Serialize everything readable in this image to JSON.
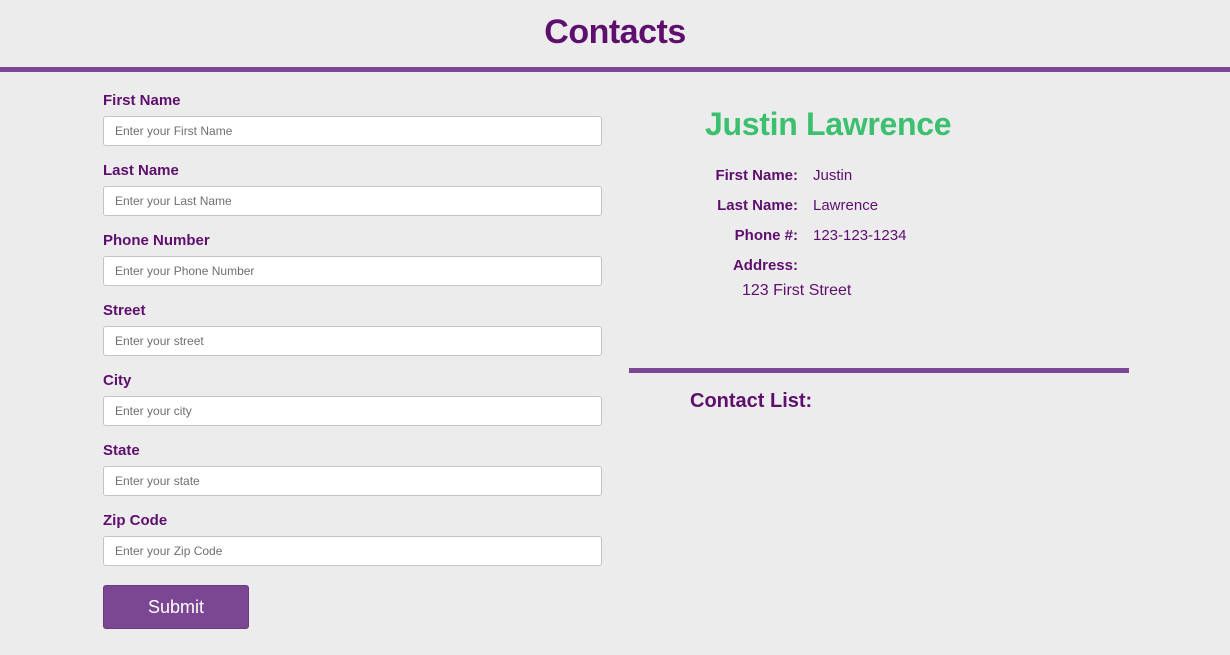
{
  "header": {
    "title": "Contacts"
  },
  "form": {
    "fields": [
      {
        "label": "First Name",
        "placeholder": "Enter your First Name"
      },
      {
        "label": "Last Name",
        "placeholder": "Enter your Last Name"
      },
      {
        "label": "Phone Number",
        "placeholder": "Enter your Phone Number"
      },
      {
        "label": "Street",
        "placeholder": "Enter your street"
      },
      {
        "label": "City",
        "placeholder": "Enter your city"
      },
      {
        "label": "State",
        "placeholder": "Enter your state"
      },
      {
        "label": "Zip Code",
        "placeholder": "Enter your Zip Code"
      }
    ],
    "submit_label": "Submit"
  },
  "detail": {
    "name": "Justin Lawrence",
    "rows": [
      {
        "key": "First Name:",
        "value": "Justin"
      },
      {
        "key": "Last Name:",
        "value": "Lawrence"
      },
      {
        "key": "Phone #:",
        "value": "123-123-1234"
      },
      {
        "key": "Address:",
        "value": ""
      }
    ],
    "address": "123 First Street"
  },
  "contact_list": {
    "title": "Contact List:"
  },
  "colors": {
    "primary_purple": "#7b4793",
    "text_purple": "#5e0f6e",
    "name_green": "#3cbf6e",
    "background": "#ececec"
  }
}
